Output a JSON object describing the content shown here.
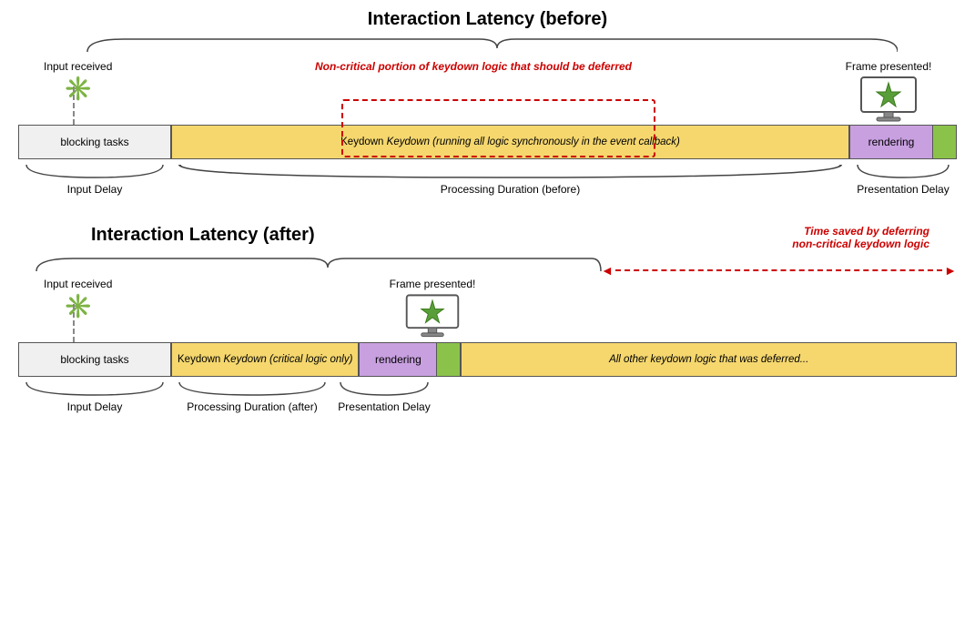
{
  "diagram": {
    "section_before": {
      "title": "Interaction Latency (before)",
      "input_label": "Input received",
      "frame_label": "Frame presented!",
      "bar_blocking": "blocking tasks",
      "bar_keydown": "Keydown (running all logic synchronously in the event callback)",
      "bar_rendering": "rendering",
      "annotation_red": "Non-critical portion of keydown\nlogic that should be deferred",
      "brace_input_delay": "Input Delay",
      "brace_processing": "Processing Duration (before)",
      "brace_presentation": "Presentation Delay"
    },
    "section_after": {
      "title": "Interaction Latency (after)",
      "input_label": "Input received",
      "frame_label": "Frame presented!",
      "bar_blocking": "blocking tasks",
      "bar_keydown": "Keydown (critical logic only)",
      "bar_rendering": "rendering",
      "bar_deferred": "All other keydown logic that was deferred...",
      "annotation_time_saved": "Time saved by deferring\nnon-critical keydown logic",
      "brace_input_delay": "Input Delay",
      "brace_processing": "Processing Duration (after)",
      "brace_presentation": "Presentation Delay"
    }
  }
}
